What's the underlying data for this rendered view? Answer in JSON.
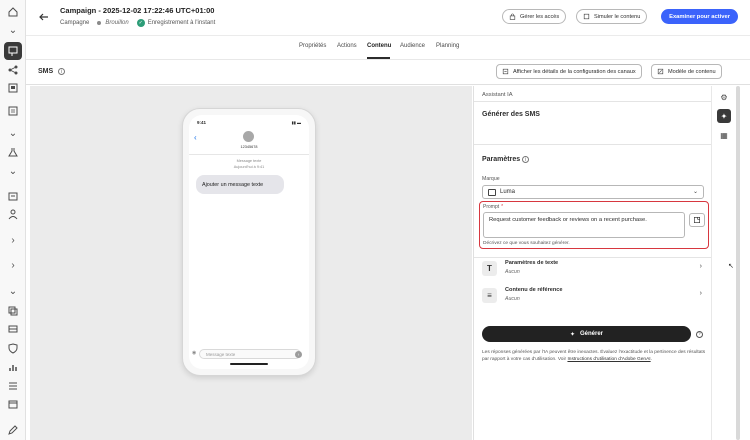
{
  "header": {
    "title": "Campaign - 2025-12-02 17:22:46 UTC+01:00",
    "subtitle": "Campagne",
    "state": "Brouillon",
    "save_status": "Enregistrement à l'instant",
    "manage_access": "Gérer les accès",
    "simulate": "Simuler le contenu",
    "review_activate": "Examiner pour activer"
  },
  "tabs": [
    {
      "label": "Propriétés",
      "active": false
    },
    {
      "label": "Actions",
      "active": false
    },
    {
      "label": "Contenu",
      "active": true
    },
    {
      "label": "Audience",
      "active": false
    },
    {
      "label": "Planning",
      "active": false
    }
  ],
  "sms_bar": {
    "title": "SMS",
    "show_config": "Afficher les détails de la configuration des canaux",
    "content_template": "Modèle de contenu"
  },
  "phone": {
    "time": "9:41",
    "contact": "12345678",
    "meta_line1": "Message texte",
    "meta_line2": "Aujourd'hui à 9:41",
    "bubble_text": "Ajouter un message texte",
    "input_placeholder": "Message texte"
  },
  "panel": {
    "section_label": "Assistant IA",
    "title": "Générer des SMS",
    "params_title": "Paramètres",
    "brand_label": "Marque",
    "brand_value": "Luma",
    "prompt_label": "Prompt",
    "prompt_required_marker": "*",
    "prompt_value": "Request customer feedback or reviews on a recent purchase.",
    "prompt_help": "Décrivez ce que vous souhaitez générer.",
    "text_params_title": "Paramètres de texte",
    "text_params_value": "Aucun",
    "ref_content_title": "Contenu de référence",
    "ref_content_value": "Aucun",
    "generate_label": "Générer",
    "disclaimer_text": "Les réponses générées par l'IA peuvent être inexactes. Évaluez l'exactitude et la pertinence des résultats par rapport à votre cas d'utilisation. Voir",
    "disclaimer_link": "Instructions d'utilisation d'Adobe GenAI",
    "disclaimer_end": "."
  },
  "accent_color": "#3b63fb",
  "highlight_color": "#d7373f"
}
